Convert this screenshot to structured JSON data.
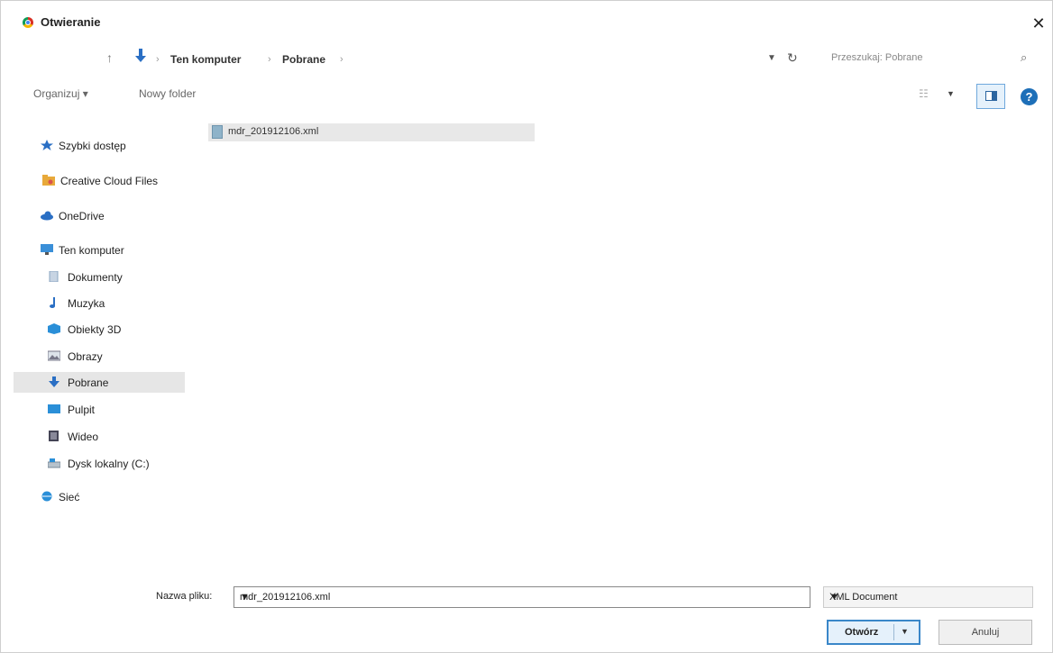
{
  "window": {
    "title": "Otwieranie",
    "close_label": "✕"
  },
  "address": {
    "crumbs": [
      "Ten komputer",
      "Pobrane"
    ],
    "search_placeholder": "Przeszukaj: Pobrane"
  },
  "toolbar": {
    "organize_label": "Organizuj ▾",
    "new_folder_label": "Nowy folder"
  },
  "sidebar": {
    "items": [
      {
        "label": "Szybki dostęp",
        "icon": "star-icon",
        "color": "#2a6fc4"
      },
      {
        "label": "Creative Cloud Files",
        "icon": "folder-icon",
        "color": "#e8a93a"
      },
      {
        "label": "OneDrive",
        "icon": "cloud-icon",
        "color": "#2a6fc4"
      },
      {
        "label": "Ten komputer",
        "icon": "computer-icon",
        "color": "#3a8fd8"
      },
      {
        "label": "Dokumenty",
        "icon": "document-icon",
        "color": "#8aa4c0"
      },
      {
        "label": "Muzyka",
        "icon": "music-icon",
        "color": "#2a6fc4"
      },
      {
        "label": "Obiekty 3D",
        "icon": "cube-icon",
        "color": "#2a8fd8"
      },
      {
        "label": "Obrazy",
        "icon": "image-icon",
        "color": "#778"
      },
      {
        "label": "Pobrane",
        "icon": "download-icon",
        "color": "#2a6fc4"
      },
      {
        "label": "Pulpit",
        "icon": "desktop-icon",
        "color": "#2a8fd8"
      },
      {
        "label": "Wideo",
        "icon": "video-icon",
        "color": "#445"
      },
      {
        "label": "Dysk lokalny (C:)",
        "icon": "drive-icon",
        "color": "#7a8a99"
      },
      {
        "label": "Sieć",
        "icon": "network-icon",
        "color": "#2a8fd8"
      }
    ]
  },
  "files": [
    {
      "name": "mdr_201912106.xml"
    }
  ],
  "bottom": {
    "filename_label": "Nazwa pliku:",
    "filename_value": "mdr_201912106.xml",
    "filetype_value": "XML Document",
    "open_label": "Otwórz",
    "cancel_label": "Anuluj"
  }
}
